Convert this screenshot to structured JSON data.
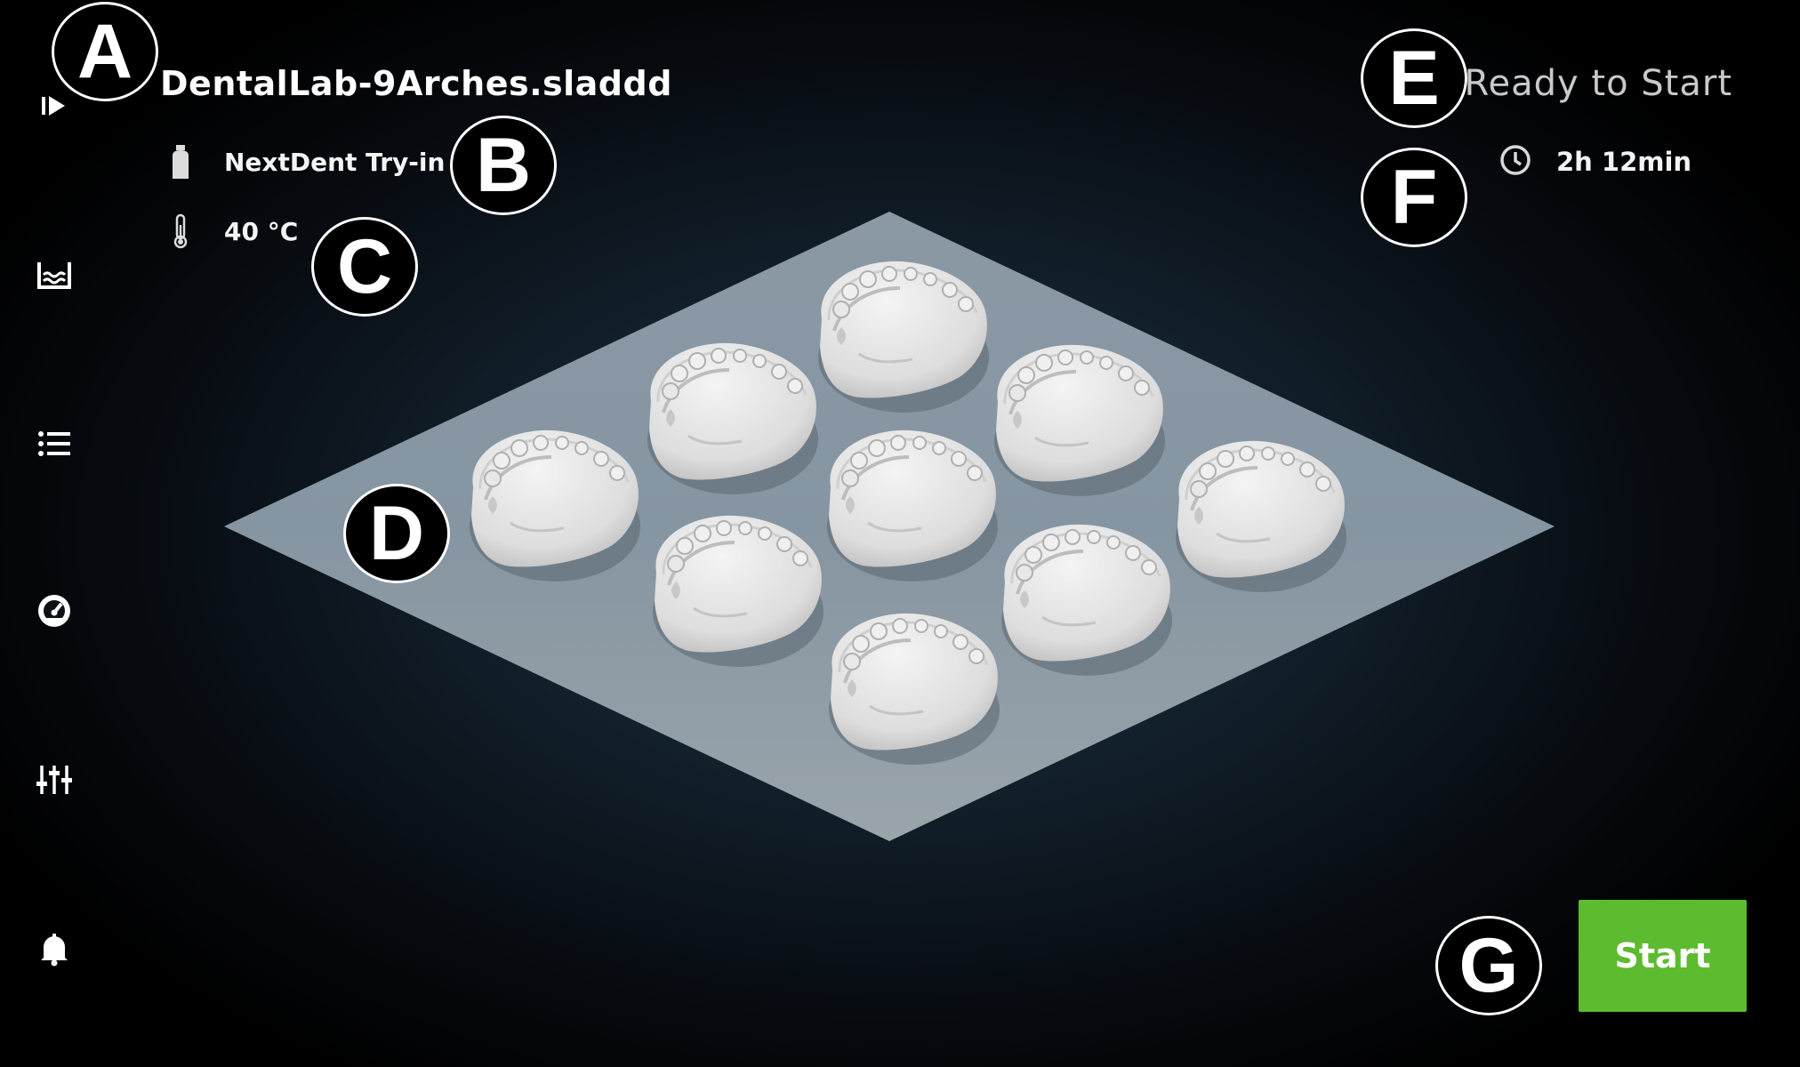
{
  "job": {
    "file_name": "DentalLab-9Arches.sladdd",
    "resin": "NextDent Try-in",
    "temperature": "40 °C",
    "status": "Ready to Start",
    "estimated_time": "2h 12min"
  },
  "sidebar": {
    "items": [
      {
        "icon": "play-print-icon"
      },
      {
        "icon": "resin-tank-icon"
      },
      {
        "icon": "job-list-icon"
      },
      {
        "icon": "dashboard-gauge-icon"
      },
      {
        "icon": "settings-sliders-icon"
      },
      {
        "icon": "notifications-bell-icon"
      }
    ]
  },
  "build_plate": {
    "model_count": 9,
    "colors": {
      "plate": "#8d9ca8",
      "model": "#e6e6e6"
    }
  },
  "callouts": [
    "A",
    "B",
    "C",
    "D",
    "E",
    "F",
    "G"
  ],
  "actions": {
    "start_label": "Start"
  },
  "colors": {
    "accent": "#5dbb2f",
    "status_text": "#c9c9c9",
    "background": "#000000"
  }
}
